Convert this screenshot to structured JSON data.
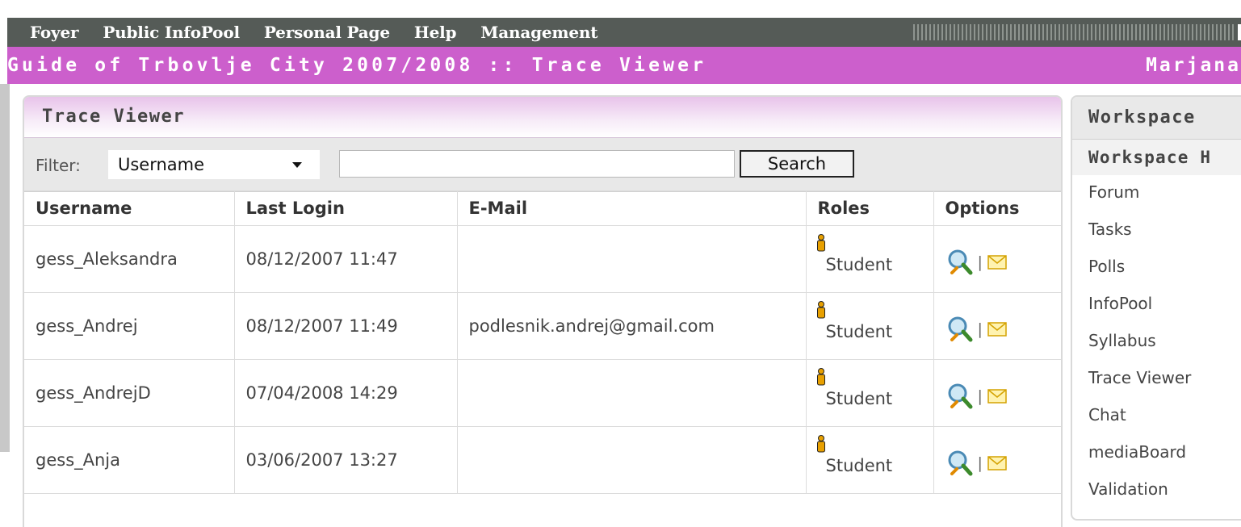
{
  "nav": {
    "items": [
      "Foyer",
      "Public InfoPool",
      "Personal Page",
      "Help",
      "Management"
    ]
  },
  "titlebar": {
    "title": "Guide of Trbovlje City 2007/2008 :: Trace Viewer",
    "user": "Marjana"
  },
  "panel": {
    "title": "Trace Viewer",
    "filter_label": "Filter:",
    "filter_value": "Username",
    "search_value": "",
    "search_button": "Search"
  },
  "table": {
    "headers": [
      "Username",
      "Last Login",
      "E-Mail",
      "Roles",
      "Options"
    ],
    "rows": [
      {
        "username": "gess_Aleksandra",
        "last_login": "08/12/2007 11:47",
        "email": "",
        "role": "Student"
      },
      {
        "username": "gess_Andrej",
        "last_login": "08/12/2007 11:49",
        "email": "podlesnik.andrej@gmail.com",
        "role": "Student"
      },
      {
        "username": "gess_AndrejD",
        "last_login": "07/04/2008 14:29",
        "email": "",
        "role": "Student"
      },
      {
        "username": "gess_Anja",
        "last_login": "03/06/2007 13:27",
        "email": "",
        "role": "Student"
      }
    ],
    "option_separator": "|"
  },
  "workspace": {
    "title": "Workspace",
    "subtitle": "Workspace H",
    "items": [
      "Forum",
      "Tasks",
      "Polls",
      "InfoPool",
      "Syllabus",
      "Trace Viewer",
      "Chat",
      "mediaBoard",
      "Validation"
    ]
  },
  "colors": {
    "nav_bg": "#555b57",
    "title_bg": "#cc5fcc",
    "panel_head": "#e8c3ea"
  }
}
